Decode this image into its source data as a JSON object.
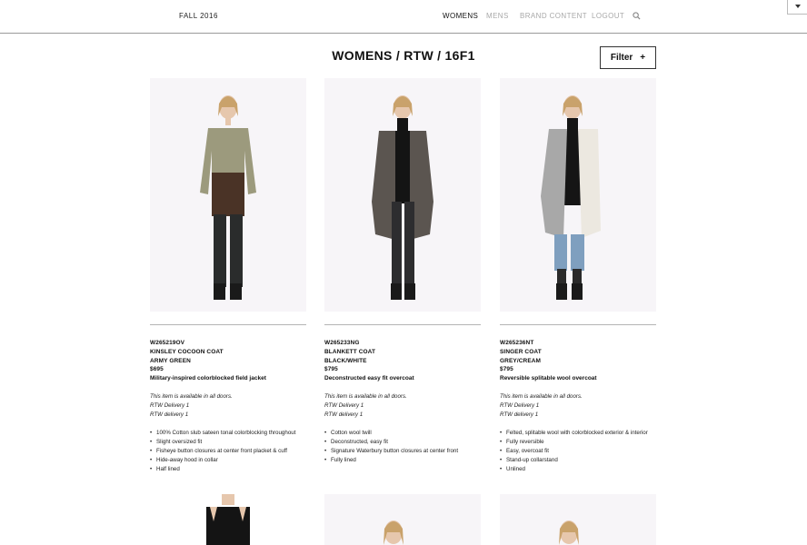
{
  "header": {
    "season": "FALL 2016",
    "nav": [
      {
        "label": "WOMENS",
        "active": true
      },
      {
        "label": "MENS",
        "active": false
      },
      {
        "label": "BRAND CONTENT",
        "active": false
      },
      {
        "label": "LOGOUT",
        "active": false
      }
    ],
    "search_icon": "search-icon",
    "dropdown_icon": "caret-down-icon"
  },
  "page": {
    "title": "WOMENS / RTW / 16F1",
    "filter_label": "Filter",
    "filter_icon": "+"
  },
  "products": [
    {
      "sku": "W265219OV",
      "name": "KINSLEY COCOON COAT",
      "color": "ARMY GREEN",
      "price": "$695",
      "description": "Military-inspired colorblocked field jacket",
      "availability": "This item is available in all doors.",
      "delivery_lines": [
        "RTW Delivery 1",
        "RTW delivery 1"
      ],
      "features": [
        "100% Cotton slub sateen tonal colorblocking throughout",
        "Slight oversized fit",
        "Fisheye button closures at center front placket & cuff",
        "Hide-away hood in collar",
        "Half lined"
      ],
      "colors": {
        "top": "#9c9a7d",
        "bottom": "#4a3326",
        "pants": "#2a2c2c",
        "boots": "#1a1a1a"
      }
    },
    {
      "sku": "W265233NG",
      "name": "BLANKETT COAT",
      "color": "BLACK/WHITE",
      "price": "$795",
      "description": "Deconstructed easy fit overcoat",
      "availability": "This item is available in all doors.",
      "delivery_lines": [
        "RTW Delivery 1",
        "RTW delivery 1"
      ],
      "features": [
        "Cotton wool twill",
        "Deconstructed, easy fit",
        "Signature Waterbury button closures at center front",
        "Fully lined"
      ],
      "colors": {
        "coat": "#5b5550",
        "inner": "#141414",
        "pants": "#2d2d2f",
        "boots": "#1a1a1a"
      }
    },
    {
      "sku": "W265236NT",
      "name": "SINGER COAT",
      "color": "GREY/CREAM",
      "price": "$795",
      "description": "Reversible splitable wool overcoat",
      "availability": "This item is available in all doors.",
      "delivery_lines": [
        "RTW Delivery 1",
        "RTW delivery 1"
      ],
      "features": [
        "Felted, splitable wool with colorblocked exterior & interior",
        "Fully reversible",
        "Easy, overcoat fit",
        "Stand-up collarstand",
        "Unlined"
      ],
      "colors": {
        "coat": "#a8a8a8",
        "facing": "#ece8e0",
        "inner": "#151515",
        "jeans": "#7f9fbf",
        "boots": "#1a1a1a"
      }
    }
  ]
}
